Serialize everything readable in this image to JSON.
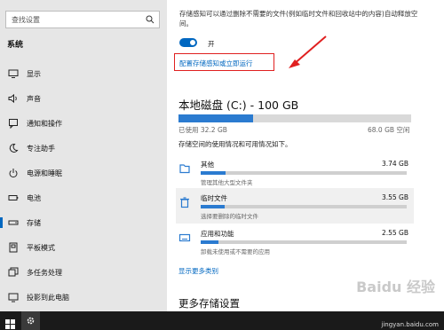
{
  "sidebar": {
    "search_placeholder": "查找设置",
    "section_title": "系统",
    "items": [
      {
        "label": "显示",
        "icon": "monitor-icon"
      },
      {
        "label": "声音",
        "icon": "speaker-icon"
      },
      {
        "label": "通知和操作",
        "icon": "notification-icon"
      },
      {
        "label": "专注助手",
        "icon": "moon-icon"
      },
      {
        "label": "电源和睡眠",
        "icon": "power-icon"
      },
      {
        "label": "电池",
        "icon": "battery-icon"
      },
      {
        "label": "存储",
        "icon": "storage-icon",
        "active": true
      },
      {
        "label": "平板模式",
        "icon": "tablet-icon"
      },
      {
        "label": "多任务处理",
        "icon": "multitask-icon"
      },
      {
        "label": "投影到此电脑",
        "icon": "project-icon"
      }
    ]
  },
  "main": {
    "storage_sense_desc": "存储感知可以通过删除不需要的文件(例如临时文件和回收站中的内容)自动释放空间。",
    "toggle_label": "开",
    "configure_link": "配置存储感知或立即运行",
    "disk_title": "本地磁盘 (C:) - 100 GB",
    "used_label": "已使用 32.2 GB",
    "free_label": "68.0 GB 空闲",
    "used_fraction": 0.322,
    "usage_desc": "存储空间的使用情况和可用情况如下。",
    "categories": [
      {
        "name": "其他",
        "size": "3.74 GB",
        "desc": "管理其他大型文件夹",
        "icon": "folder-icon",
        "fraction": 0.12
      },
      {
        "name": "临时文件",
        "size": "3.55 GB",
        "desc": "选择要删除的临时文件",
        "icon": "trash-icon",
        "fraction": 0.115
      },
      {
        "name": "应用和功能",
        "size": "2.55 GB",
        "desc": "卸载未使用或不需要的应用",
        "icon": "keyboard-icon",
        "fraction": 0.085
      }
    ],
    "more_categories_link": "显示更多类别",
    "more_settings_title": "更多存储设置"
  },
  "watermark": {
    "site": "jingyan.baidu.com",
    "logo": "Baidu 经验"
  },
  "colors": {
    "accent": "#0067c0",
    "annotation": "#e02020"
  }
}
